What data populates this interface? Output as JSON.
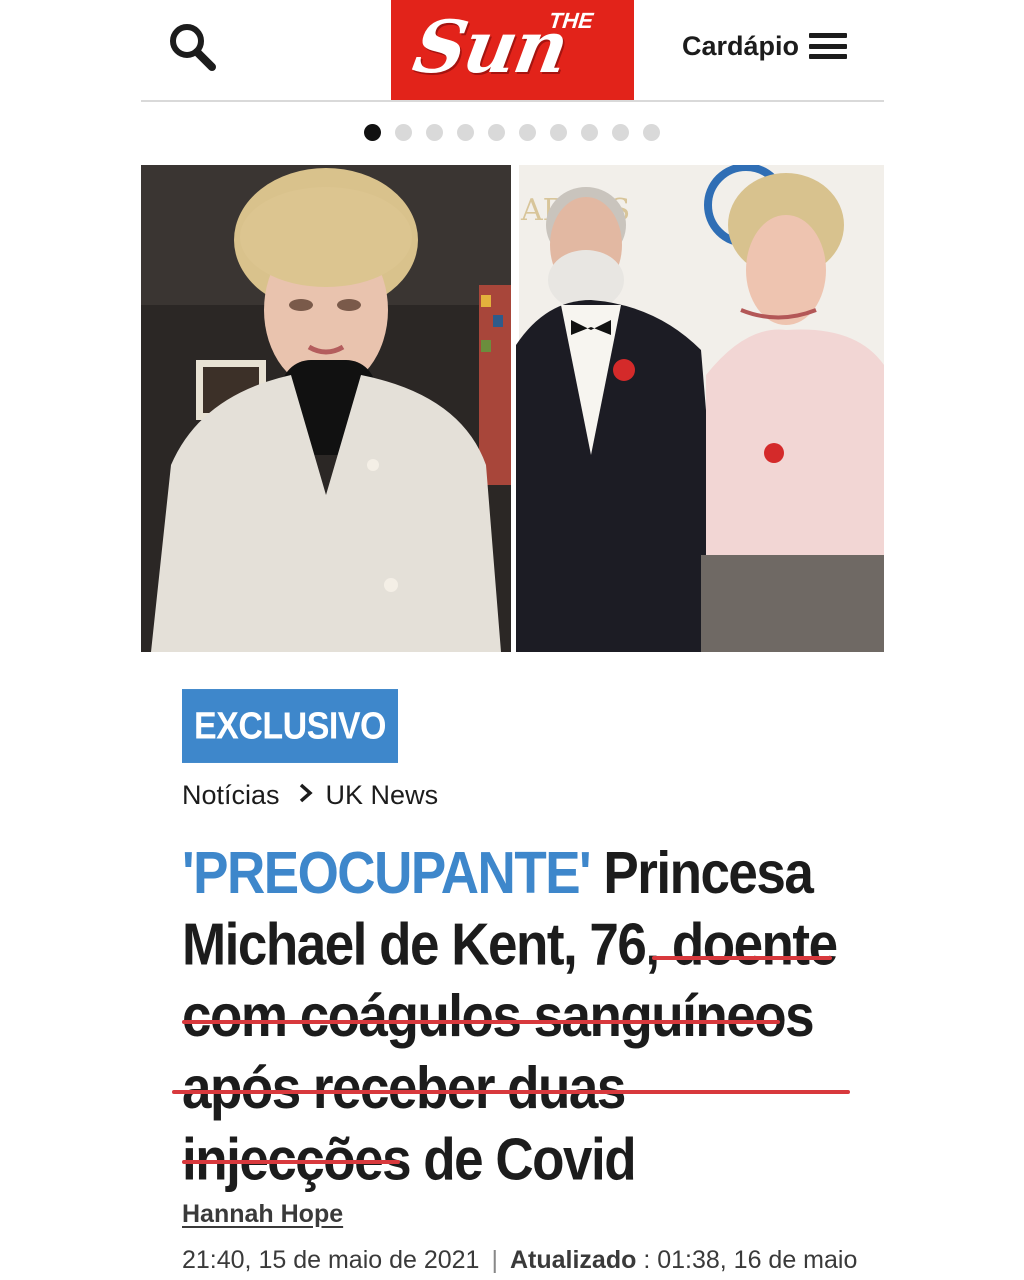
{
  "header": {
    "logo_small": "THE",
    "logo_big": "Sun",
    "menu_label": "Cardápio",
    "brand_color": "#e2231a"
  },
  "carousel": {
    "count": 10,
    "active_index": 1
  },
  "images": {
    "left": "portrait-woman-beige-coat",
    "right": "couple-at-event"
  },
  "article": {
    "badge": "EXCLUSIVO",
    "breadcrumb": [
      "Notícias",
      "UK News"
    ],
    "headline_kicker": "'PREOCUPANTE'",
    "headline_text": " Princesa Michael de Kent, 76, doente com coágulos sanguíneos após receber duas injecções de Covid",
    "author": "Hannah Hope",
    "published": "21:40, 15 de maio de 2021",
    "updated_label": "Atualizado",
    "updated_sep": " : ",
    "updated": "01:38, 16 de maio",
    "accent_color": "#3e87cb",
    "highlight_color": "#d8393d"
  }
}
